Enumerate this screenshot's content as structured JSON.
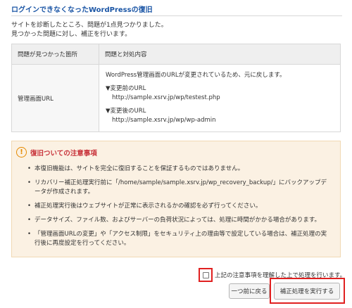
{
  "page": {
    "title": "ログインできなくなったWordPressの復旧",
    "intro_line1": "サイトを診断したところ、問題が1点見つかりました。",
    "intro_line2": "見つかった問題に対し、補正を行います。"
  },
  "table": {
    "headers": [
      "問題が見つかった箇所",
      "問題と対処内容"
    ],
    "rows": [
      {
        "location": "管理画面URL",
        "description": "WordPress管理画面のURLが変更されているため、元に戻します。",
        "before_label": "▼変更前のURL",
        "before_url": "http://sample.xsrv.jp/wp/testest.php",
        "after_label": "▼変更後のURL",
        "after_url": "http://sample.xsrv.jp/wp/wp-admin"
      }
    ]
  },
  "notice": {
    "icon": "exclamation-circle-icon",
    "title": "復旧ついての注意事項",
    "items": [
      "本復旧機能は、サイトを完全に復旧することを保証するものではありません。",
      "リカバリー補正処理実行前に「/home/sample/sample.xsrv.jp/wp_recovery_backup/」にバックアップデータが作成されます。",
      "補正処理実行後はウェブサイトが正常に表示されるかの確認を必ず行ってください。",
      "データサイズ、ファイル数、およびサーバーの負荷状況によっては、処理に時間がかかる場合があります。",
      "「管理画面URLの変更」や「アクセス制限」をセキュリティ上の理由等で設定している場合は、補正処理の実行後に再度設定を行ってください。"
    ]
  },
  "agree": {
    "label": "上記の注意事項を理解した上で処理を行います。",
    "checked": false
  },
  "buttons": {
    "back": "一つ前に戻る",
    "run": "補正処理を実行する"
  },
  "colors": {
    "title": "#1a55a5",
    "notice_bg": "#fbf1e3",
    "notice_title": "#c8323a",
    "warn_icon": "#e58a00",
    "highlight": "#e02020"
  }
}
